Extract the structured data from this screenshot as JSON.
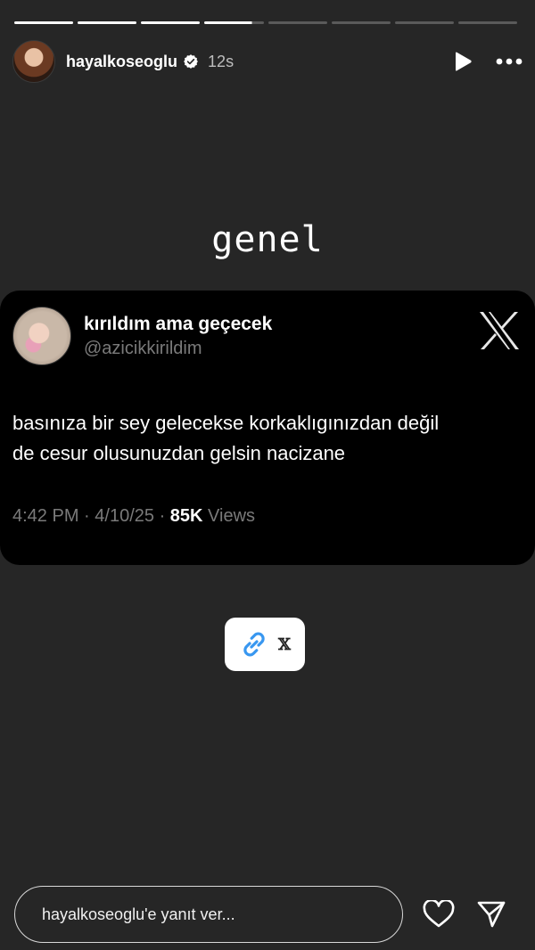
{
  "header": {
    "username": "hayalkoseoglu",
    "time": "12s"
  },
  "progress": {
    "total_segments": 8,
    "current_index": 3,
    "current_fraction": 0.8
  },
  "story_title": "genel",
  "tweet": {
    "display_name": "kırıldım ama geçecek",
    "handle": "@azicikkirildim",
    "text_line1": "basınıza bir sey gelecekse korkaklıgınızdan değil",
    "text_line2": "de cesur olusunuzdan gelsin nacizane",
    "time": "4:42 PM",
    "date": "4/10/25",
    "views_count": "85K",
    "views_label": "Views"
  },
  "link_sticker": {
    "label": "𝕏"
  },
  "reply": {
    "placeholder": "hayalkoseoglu'e yanıt ver..."
  },
  "colors": {
    "background": "#262626",
    "card": "#000000",
    "link_blue": "#3897f0",
    "muted": "#7a7a7a"
  }
}
